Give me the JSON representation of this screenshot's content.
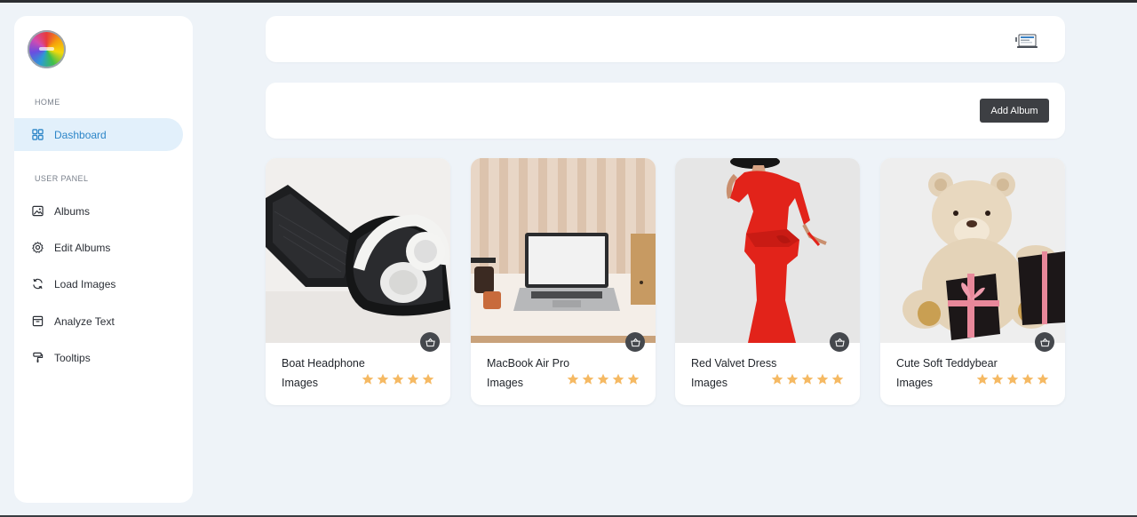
{
  "sidebar": {
    "sections": [
      {
        "label": "HOME"
      },
      {
        "label": "USER PANEL"
      }
    ],
    "items": [
      {
        "label": "Dashboard",
        "icon": "grid-icon",
        "active": true
      },
      {
        "label": "Albums",
        "icon": "image-icon"
      },
      {
        "label": "Edit Albums",
        "icon": "gear-icon"
      },
      {
        "label": "Load Images",
        "icon": "refresh-icon"
      },
      {
        "label": "Analyze Text",
        "icon": "archive-icon"
      },
      {
        "label": "Tooltips",
        "icon": "paint-roller-icon"
      }
    ]
  },
  "toolbar": {
    "add_album_label": "Add Album"
  },
  "colors": {
    "accent": "#2d86c8",
    "active_bg": "#e2f0fb",
    "button_bg": "#3d3f43",
    "star": "#f5b963",
    "background": "#eef3f8"
  },
  "cards": [
    {
      "title": "Boat Headphone",
      "subtitle": "Images",
      "rating": 5,
      "image": "headphone-case"
    },
    {
      "title": "MacBook Air Pro",
      "subtitle": "Images",
      "rating": 5,
      "image": "laptop-desk"
    },
    {
      "title": "Red Valvet Dress",
      "subtitle": "Images",
      "rating": 5,
      "image": "red-dress"
    },
    {
      "title": "Cute Soft Teddybear",
      "subtitle": "Images",
      "rating": 5,
      "image": "teddybear"
    }
  ]
}
